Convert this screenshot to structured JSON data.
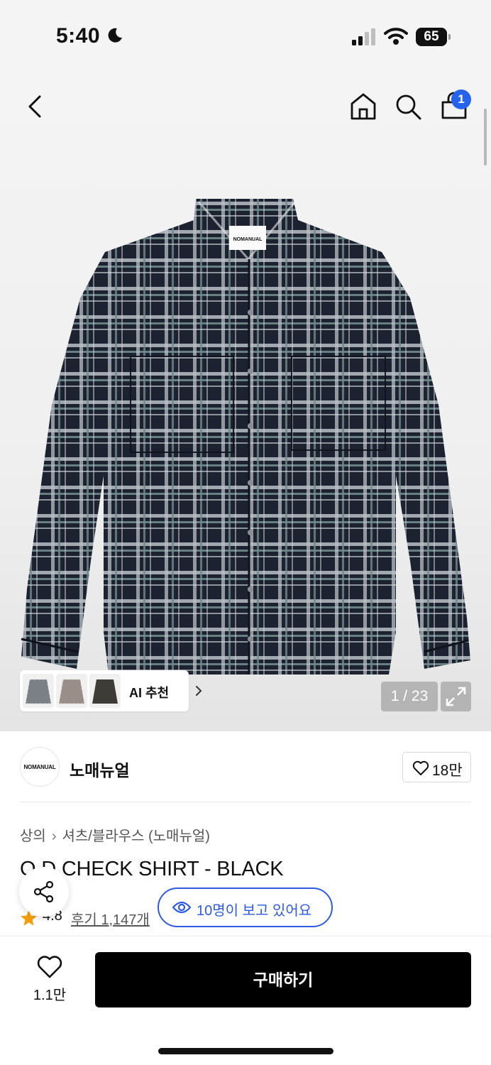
{
  "status_bar": {
    "time": "5:40",
    "battery": "65"
  },
  "nav": {
    "cart_count": "1"
  },
  "gallery": {
    "ai_label": "AI 추천",
    "page_counter": "1 / 23",
    "shirt_logo_text": "NOMANUAL"
  },
  "brand": {
    "logo_text": "NOMANUAL",
    "name": "노매뉴얼",
    "likes": "18만"
  },
  "product": {
    "breadcrumb": [
      "상의",
      "셔츠/블라우스 (노매뉴얼)"
    ],
    "title": "O.D CHECK SHIRT - BLACK",
    "rating": "4.8",
    "reviews": "후기 1,147개",
    "viewers": "10명이 보고 있어요"
  },
  "bottom": {
    "fav_count": "1.1만",
    "buy_label": "구매하기"
  },
  "colors": {
    "accent_blue": "#2f5be3",
    "badge_blue": "#2563eb",
    "star": "#f59e0b",
    "buy_button": "#000000"
  },
  "icons": [
    "moon-icon",
    "signal-icon",
    "wifi-icon",
    "battery-icon",
    "back-icon",
    "home-icon",
    "search-icon",
    "cart-icon",
    "chevron-right-icon",
    "expand-icon",
    "heart-icon",
    "star-icon",
    "eye-icon",
    "share-icon"
  ]
}
